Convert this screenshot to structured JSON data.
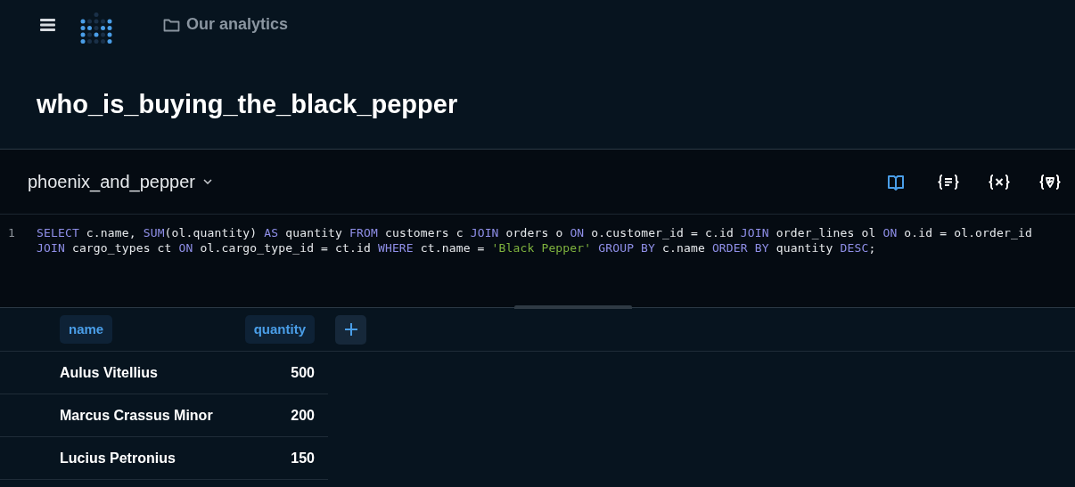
{
  "breadcrumb": {
    "label": "Our analytics"
  },
  "title": "who_is_buying_the_black_pepper",
  "database": {
    "label": "phoenix_and_pepper"
  },
  "toolbar": [
    {
      "kind": "book",
      "selected": true
    },
    {
      "kind": "braces-lines",
      "selected": false
    },
    {
      "kind": "braces-x",
      "selected": false
    },
    {
      "kind": "braces-shield",
      "selected": false
    }
  ],
  "editor": {
    "line_number": "1",
    "rows": [
      {
        "segments": [
          {
            "kind": "keyword",
            "text": "SELECT"
          },
          {
            "kind": "plain",
            "text": " c.name, "
          },
          {
            "kind": "keyword",
            "text": "SUM"
          },
          {
            "kind": "plain",
            "text": "(ol.quantity) "
          },
          {
            "kind": "keyword",
            "text": "AS"
          },
          {
            "kind": "plain",
            "text": " quantity "
          },
          {
            "kind": "keyword",
            "text": "FROM"
          },
          {
            "kind": "plain",
            "text": " customers c "
          },
          {
            "kind": "keyword",
            "text": "JOIN"
          },
          {
            "kind": "plain",
            "text": " orders o "
          },
          {
            "kind": "keyword",
            "text": "ON"
          },
          {
            "kind": "plain",
            "text": " o.customer_id = c.id "
          },
          {
            "kind": "keyword",
            "text": "JOIN"
          },
          {
            "kind": "plain",
            "text": " order_lines ol "
          },
          {
            "kind": "keyword",
            "text": "ON"
          },
          {
            "kind": "plain",
            "text": " o.id = ol.order_id"
          }
        ]
      },
      {
        "segments": [
          {
            "kind": "keyword",
            "text": "JOIN"
          },
          {
            "kind": "plain",
            "text": " cargo_types ct "
          },
          {
            "kind": "keyword",
            "text": "ON"
          },
          {
            "kind": "plain",
            "text": " ol.cargo_type_id = ct.id "
          },
          {
            "kind": "keyword",
            "text": "WHERE"
          },
          {
            "kind": "plain",
            "text": " ct.name = "
          },
          {
            "kind": "string",
            "text": "'Black Pepper'"
          },
          {
            "kind": "keyword",
            "text": " GROUP BY"
          },
          {
            "kind": "plain",
            "text": " c.name "
          },
          {
            "kind": "keyword",
            "text": "ORDER BY"
          },
          {
            "kind": "plain",
            "text": " quantity "
          },
          {
            "kind": "keyword",
            "text": "DESC"
          },
          {
            "kind": "plain",
            "text": ";"
          }
        ]
      }
    ]
  },
  "table": {
    "columns": [
      "name",
      "quantity"
    ],
    "rows": [
      [
        "Aulus Vitellius",
        "500"
      ],
      [
        "Marcus Crassus Minor",
        "200"
      ],
      [
        "Lucius Petronius",
        "150"
      ]
    ]
  }
}
